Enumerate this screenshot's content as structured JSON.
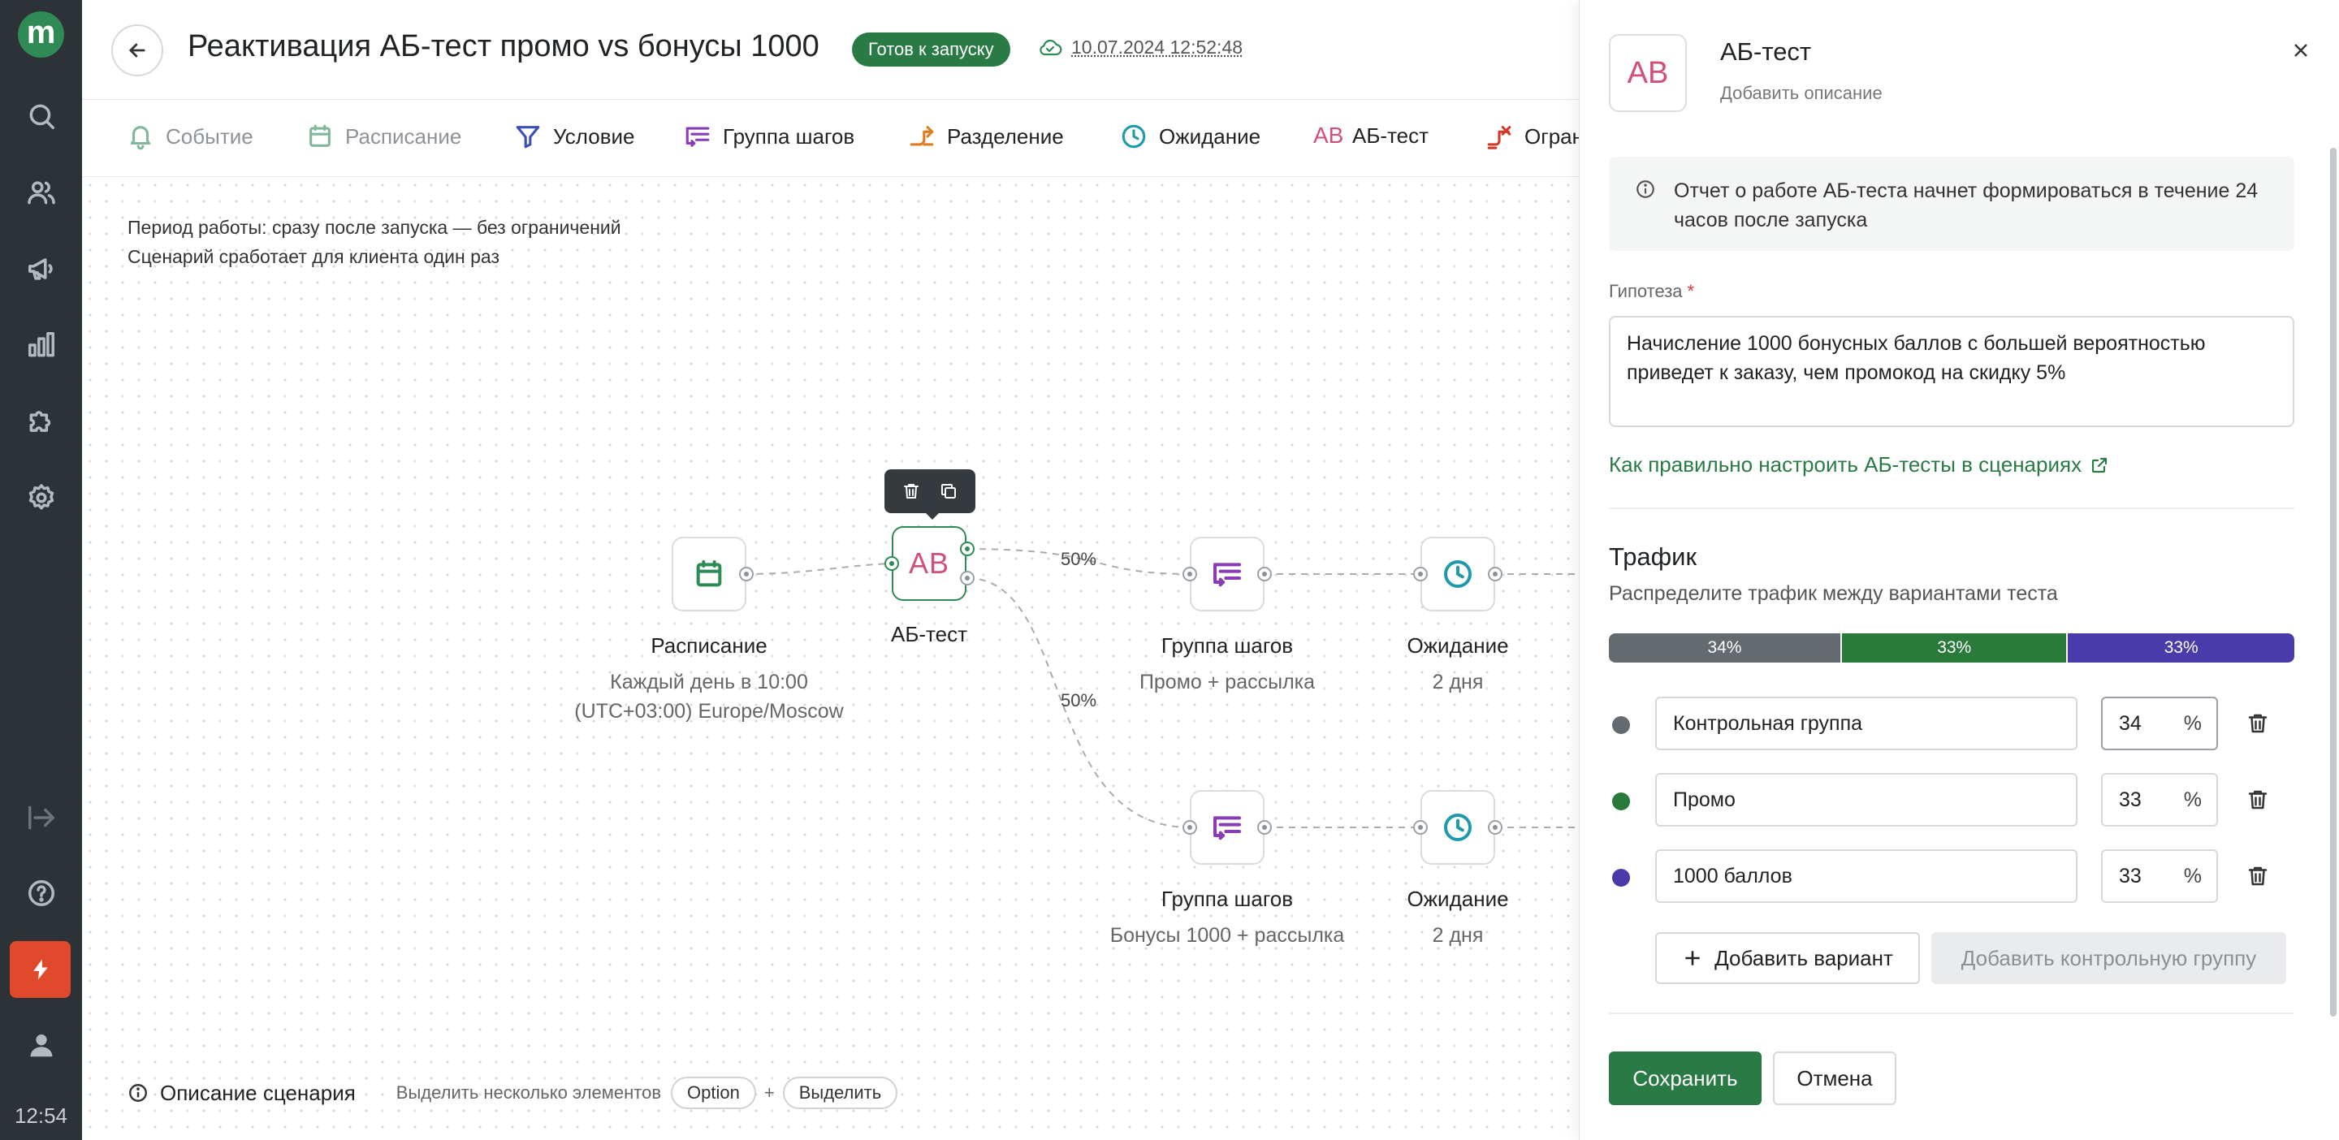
{
  "sidebar": {
    "logo_letter": "m",
    "clock": "12:54",
    "items": [
      "search-icon",
      "users-icon",
      "megaphone-icon",
      "chart-icon",
      "puzzle-icon",
      "settings-icon",
      "collapse-icon",
      "help-icon",
      "flash-icon",
      "profile-icon"
    ]
  },
  "header": {
    "title": "Реактивация АБ-тест промо vs бонусы 1000",
    "status": "Готов к запуску",
    "saved_at": "10.07.2024 12:52:48"
  },
  "toolbar": {
    "items": [
      {
        "label": "Событие",
        "icon": "bell-icon",
        "muted": true,
        "color": "#2f8a56"
      },
      {
        "label": "Расписание",
        "icon": "calendar-icon",
        "muted": true,
        "color": "#2f8a56"
      },
      {
        "label": "Условие",
        "icon": "filter-icon",
        "muted": false,
        "color": "#3b4fb8"
      },
      {
        "label": "Группа шагов",
        "icon": "steps-icon",
        "muted": false,
        "color": "#8a3bb8"
      },
      {
        "label": "Разделение",
        "icon": "split-icon",
        "muted": false,
        "color": "#e07b1e"
      },
      {
        "label": "Ожидание",
        "icon": "clock-icon",
        "muted": false,
        "color": "#1e9aa8"
      },
      {
        "label": "АБ-тест",
        "icon": "ab-icon",
        "muted": false,
        "color": "#d24f78"
      },
      {
        "label": "Ограничение",
        "icon": "limit-icon",
        "muted": false,
        "color": "#d33a2a"
      }
    ],
    "ab_glyph": "AB"
  },
  "canvas": {
    "period_line1": "Период работы: сразу после запуска — без ограничений",
    "period_line2": "Сценарий сработает для клиента один раз",
    "nodes": {
      "schedule": {
        "title": "Расписание",
        "sub1": "Каждый день в 10:00",
        "sub2": "(UTC+03:00) Europe/Moscow"
      },
      "ab": {
        "title": "АБ-тест",
        "glyph": "AB"
      },
      "group1": {
        "title": "Группа шагов",
        "sub1": "Промо + рассылка"
      },
      "wait1": {
        "title": "Ожидание",
        "sub1": "2 дня"
      },
      "group2": {
        "title": "Группа шагов",
        "sub1": "Бонусы 1000 + рассылка"
      },
      "wait2": {
        "title": "Ожидание",
        "sub1": "2 дня"
      }
    },
    "edge_labels": {
      "top": "50%",
      "bottom": "50%"
    },
    "bottom": {
      "description": "Описание сценария",
      "hint": "Выделить несколько элементов",
      "key1": "Option",
      "plus": "+",
      "key2": "Выделить"
    }
  },
  "panel": {
    "icon_glyph": "AB",
    "title": "АБ-тест",
    "subtitle": "Добавить описание",
    "info": "Отчет о работе АБ-теста начнет формироваться в течение 24 часов после запуска",
    "hypothesis_label": "Гипотеза",
    "required_mark": "*",
    "hypothesis": "Начисление 1000 бонусных баллов с большей вероятностью приведет к заказу, чем промокод на скидку 5%",
    "help_link": "Как правильно настроить АБ-тесты в сценариях",
    "traffic_title": "Трафик",
    "traffic_sub": "Распределите трафик между вариантами теста",
    "variants": [
      {
        "name": "Контрольная группа",
        "value": "34",
        "bar_label": "34%",
        "share": 34,
        "color": "#636a70",
        "active": true
      },
      {
        "name": "Промо",
        "value": "33",
        "bar_label": "33%",
        "share": 33,
        "color": "#2a7a3b",
        "active": false
      },
      {
        "name": "1000 баллов",
        "value": "33",
        "bar_label": "33%",
        "share": 33,
        "color": "#4a3bab",
        "active": false
      }
    ],
    "percent_unit": "%",
    "add_variant": "Добавить вариант",
    "add_control": "Добавить контрольную группу",
    "save": "Сохранить",
    "cancel": "Отмена"
  }
}
